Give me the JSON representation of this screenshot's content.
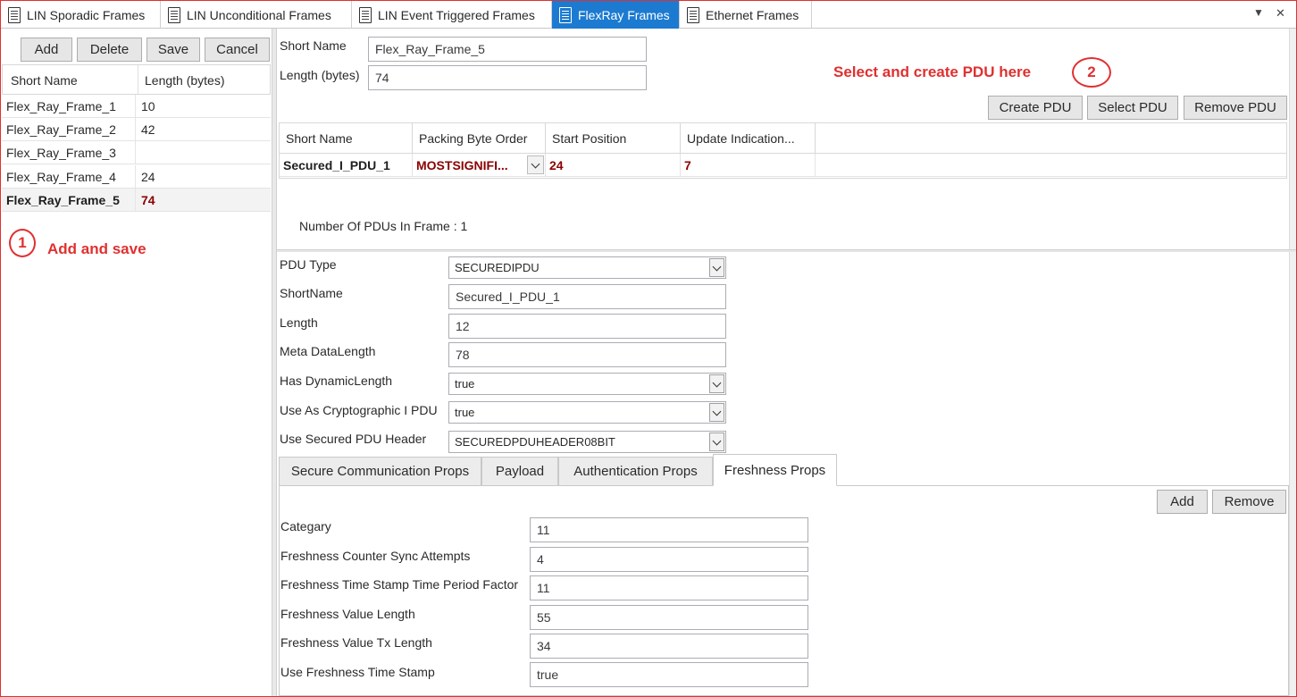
{
  "tabs": [
    {
      "label": "LIN Sporadic Frames",
      "active": false
    },
    {
      "label": "LIN Unconditional Frames",
      "active": false
    },
    {
      "label": "LIN Event Triggered Frames",
      "active": false
    },
    {
      "label": "FlexRay Frames",
      "active": true
    },
    {
      "label": "Ethernet Frames",
      "active": false
    }
  ],
  "tab_controls": {
    "dropdown_glyph": "▼",
    "close_glyph": "✕"
  },
  "left": {
    "buttons": {
      "add": "Add",
      "delete": "Delete",
      "save": "Save",
      "cancel": "Cancel"
    },
    "columns": [
      "Short Name",
      "Length (bytes)"
    ],
    "rows": [
      {
        "name": "Flex_Ray_Frame_1",
        "length": "10"
      },
      {
        "name": "Flex_Ray_Frame_2",
        "length": "42"
      },
      {
        "name": "Flex_Ray_Frame_3",
        "length": ""
      },
      {
        "name": "Flex_Ray_Frame_4",
        "length": "24"
      },
      {
        "name": "Flex_Ray_Frame_5",
        "length": "74",
        "selected": true
      }
    ],
    "annotation": {
      "number": "1",
      "text": "Add and save"
    }
  },
  "frame": {
    "short_name_label": "Short Name",
    "short_name_value": "Flex_Ray_Frame_5",
    "length_label": "Length (bytes)",
    "length_value": "74"
  },
  "pdu_annotation": {
    "number": "2",
    "text": "Select and create PDU here"
  },
  "pdu_buttons": {
    "create": "Create PDU",
    "select": "Select PDU",
    "remove": "Remove PDU"
  },
  "pdu_grid": {
    "columns": [
      "Short Name",
      "Packing Byte Order",
      "Start Position",
      "Update Indication..."
    ],
    "rows": [
      {
        "short_name": "Secured_I_PDU_1",
        "packing": "MOSTSIGNIFI...",
        "start": "24",
        "update": "7"
      }
    ]
  },
  "pdu_count": "Number Of PDUs In Frame : 1",
  "pdu_props": {
    "pdu_type": {
      "label": "PDU Type",
      "value": "SECUREDIPDU"
    },
    "short_name": {
      "label": "ShortName",
      "value": "Secured_I_PDU_1"
    },
    "length": {
      "label": "Length",
      "value": "12"
    },
    "meta_length": {
      "label": "Meta DataLength",
      "value": "78"
    },
    "dyn_length": {
      "label": "Has DynamicLength",
      "value": "true"
    },
    "crypto": {
      "label": "Use As Cryptographic I PDU",
      "value": "true"
    },
    "secured_header": {
      "label": "Use Secured PDU Header",
      "value": "SECUREDPDUHEADER08BIT"
    }
  },
  "subtabs": [
    {
      "label": "Secure Communication Props",
      "active": false
    },
    {
      "label": "Payload",
      "active": false
    },
    {
      "label": "Authentication Props",
      "active": false
    },
    {
      "label": "Freshness Props",
      "active": true
    }
  ],
  "freshness": {
    "buttons": {
      "add": "Add",
      "remove": "Remove"
    },
    "category": {
      "label": "Categary",
      "value": "11"
    },
    "sync_attempts": {
      "label": "Freshness Counter Sync Attempts",
      "value": "4"
    },
    "time_factor": {
      "label": "Freshness Time Stamp Time Period Factor",
      "value": "11"
    },
    "value_length": {
      "label": "Freshness Value Length",
      "value": "55"
    },
    "tx_length": {
      "label": "Freshness Value Tx Length",
      "value": "34"
    },
    "use_time_stamp": {
      "label": "Use Freshness Time Stamp",
      "value": "true"
    }
  },
  "colors": {
    "active_tab": "#1c7bd1",
    "annotation": "#e03030",
    "highlight_value": "#8b0000"
  }
}
